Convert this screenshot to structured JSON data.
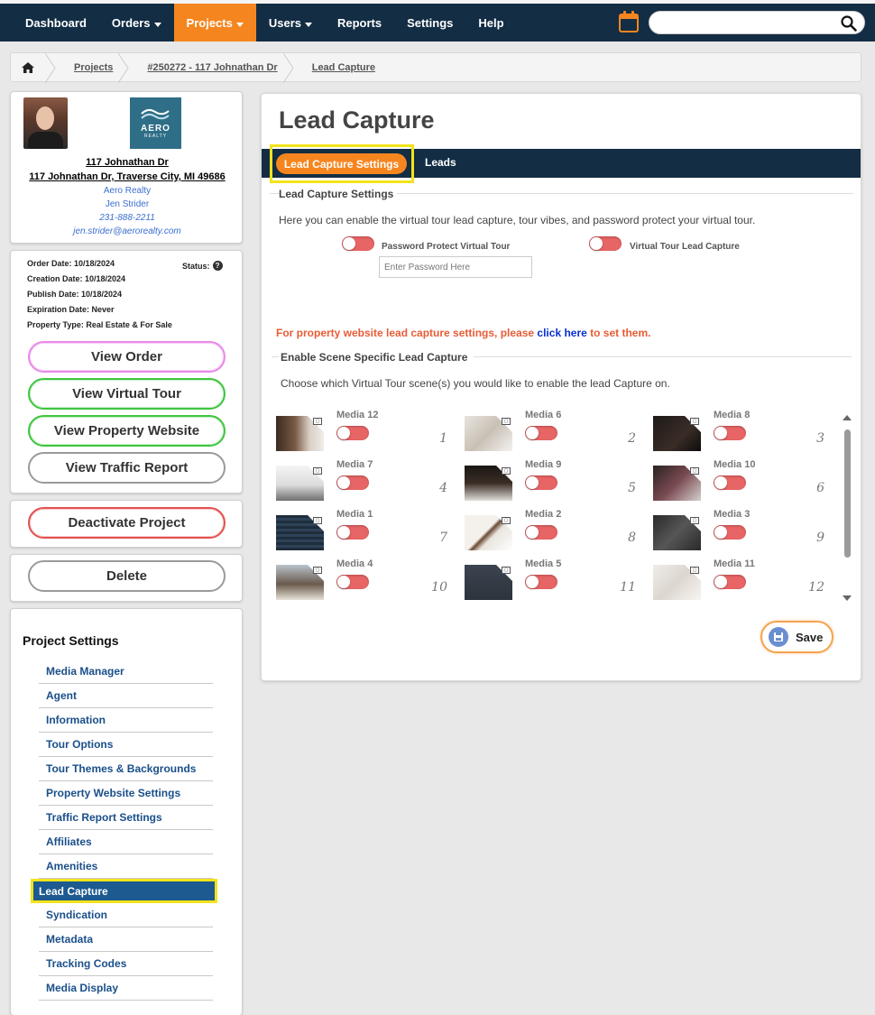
{
  "nav": {
    "items": [
      {
        "label": "Dashboard",
        "caret": false,
        "active": false
      },
      {
        "label": "Orders",
        "caret": true,
        "active": false
      },
      {
        "label": "Projects",
        "caret": true,
        "active": true
      },
      {
        "label": "Users",
        "caret": true,
        "active": false
      },
      {
        "label": "Reports",
        "caret": false,
        "active": false
      },
      {
        "label": "Settings",
        "caret": false,
        "active": false
      },
      {
        "label": "Help",
        "caret": false,
        "active": false
      }
    ],
    "search_value": ""
  },
  "breadcrumb": {
    "items": [
      "Projects",
      "#250272 - 117 Johnathan Dr",
      "Lead Capture"
    ]
  },
  "agent": {
    "logo_text": "AERO",
    "logo_subtext": "REALTY",
    "address_line1": "117 Johnathan Dr",
    "address_line2": "117 Johnathan Dr, Traverse City, MI 49686",
    "company": "Aero Realty",
    "name": "Jen Strider",
    "phone": "231-888-2211",
    "email": "jen.strider@aerorealty.com"
  },
  "order": {
    "order_date": "Order Date: 10/18/2024",
    "creation_date": "Creation Date: 10/18/2024",
    "publish_date": "Publish Date: 10/18/2024",
    "expiration_date": "Expiration Date: Never",
    "property_type": "Property Type: Real Estate & For Sale",
    "status_label": "Status:",
    "buttons": {
      "view_order": "View Order",
      "view_tour": "View Virtual Tour",
      "view_website": "View Property Website",
      "view_traffic": "View Traffic Report"
    }
  },
  "actions": {
    "deactivate": "Deactivate Project",
    "delete": "Delete"
  },
  "settings": {
    "title": "Project Settings",
    "items": [
      "Media Manager",
      "Agent",
      "Information",
      "Tour Options",
      "Tour Themes & Backgrounds",
      "Property Website Settings",
      "Traffic Report Settings",
      "Affiliates",
      "Amenities",
      "Lead Capture",
      "Syndication",
      "Metadata",
      "Tracking Codes",
      "Media Display"
    ],
    "active_index": 9
  },
  "main": {
    "title": "Lead Capture",
    "tabs": [
      "Lead Capture Settings",
      "Leads"
    ],
    "section1_title": "Lead Capture Settings",
    "section1_desc": "Here you can enable the virtual tour lead capture, tour vibes, and password protect your virtual tour.",
    "password_toggle_label": "Password Protect Virtual Tour",
    "password_placeholder": "Enter Password Here",
    "lead_toggle_label": "Virtual Tour Lead Capture",
    "notice_before": "For property website lead capture settings, please ",
    "notice_link": "click here",
    "notice_after": " to set them.",
    "section2_title": "Enable Scene Specific Lead Capture",
    "section2_desc": "Choose which Virtual Tour scene(s) you would like to enable the lead Capture on.",
    "save_label": "Save"
  },
  "media": [
    {
      "label": "Media 12",
      "num": "1"
    },
    {
      "label": "Media 6",
      "num": "2"
    },
    {
      "label": "Media 8",
      "num": "3"
    },
    {
      "label": "Media 7",
      "num": "4"
    },
    {
      "label": "Media 9",
      "num": "5"
    },
    {
      "label": "Media 10",
      "num": "6"
    },
    {
      "label": "Media 1",
      "num": "7"
    },
    {
      "label": "Media 2",
      "num": "8"
    },
    {
      "label": "Media 3",
      "num": "9"
    },
    {
      "label": "Media 4",
      "num": "10"
    },
    {
      "label": "Media 5",
      "num": "11"
    },
    {
      "label": "Media 11",
      "num": "12"
    }
  ],
  "colors": {
    "nav_bg": "#132d44",
    "accent_orange": "#f5861f",
    "toggle_off": "#e86565",
    "highlight": "#f2e31a"
  }
}
